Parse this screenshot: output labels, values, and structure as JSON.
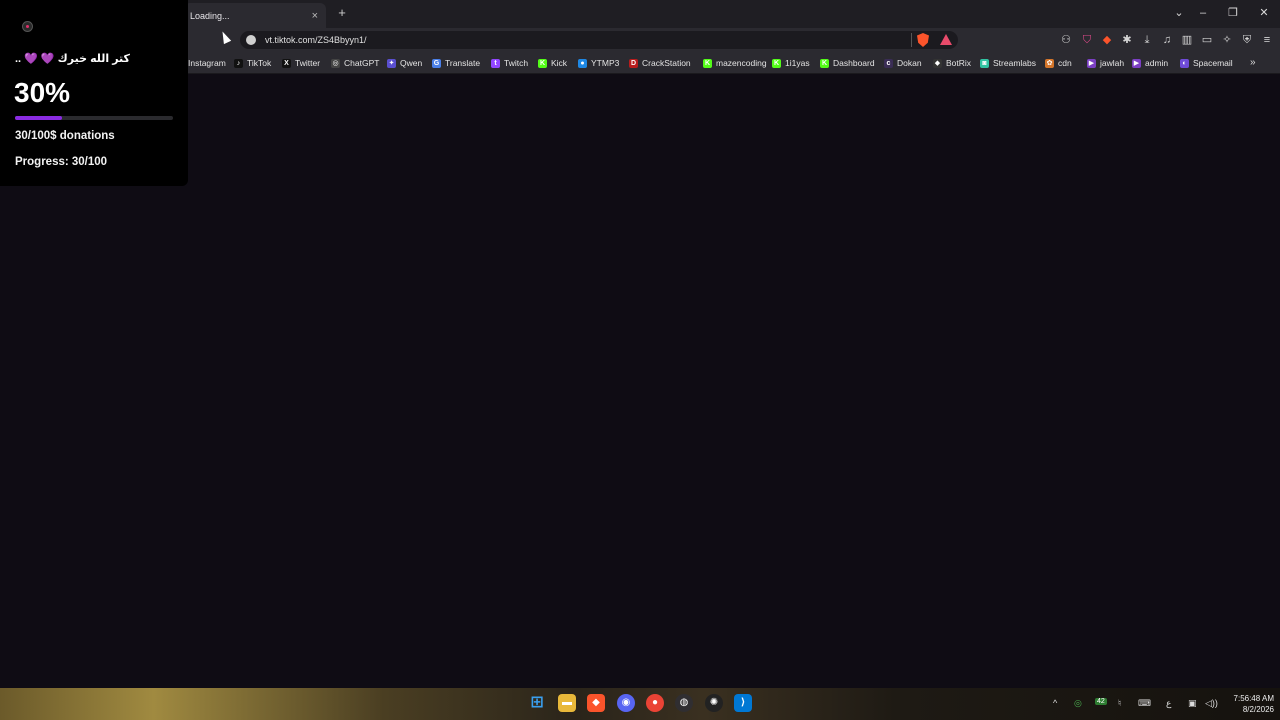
{
  "browser": {
    "tab_title": "Loading...",
    "tab_close": "×",
    "new_tab": "+",
    "url": "vt.tiktok.com/ZS4Bbyyn1/",
    "window_controls": {
      "collapse": "⌄",
      "minimize": "–",
      "restore": "❐",
      "close": "✕"
    }
  },
  "bookmarks": [
    {
      "label": "Instagram",
      "icon": "",
      "color": "#2b2a30"
    },
    {
      "label": "TikTok",
      "icon": "♪",
      "color": "#111111"
    },
    {
      "label": "Twitter",
      "icon": "X",
      "color": "#111111"
    },
    {
      "label": "ChatGPT",
      "icon": "◎",
      "color": "#444444"
    },
    {
      "label": "Qwen",
      "icon": "✦",
      "color": "#5a4fd0"
    },
    {
      "label": "Translate",
      "icon": "G",
      "color": "#4a7fe8"
    },
    {
      "label": "Twitch",
      "icon": "t",
      "color": "#9146ff"
    },
    {
      "label": "Kick",
      "icon": "K",
      "color": "#53fc18"
    },
    {
      "label": "YTMP3",
      "icon": "●",
      "color": "#1e88e5"
    },
    {
      "label": "CrackStation",
      "icon": "D",
      "color": "#b71c1c"
    },
    {
      "label": "mazencoding",
      "icon": "K",
      "color": "#53fc18"
    },
    {
      "label": "1i1yas",
      "icon": "K",
      "color": "#53fc18"
    },
    {
      "label": "Dashboard",
      "icon": "K",
      "color": "#53fc18"
    },
    {
      "label": "Dokan",
      "icon": "c",
      "color": "#3a2d55"
    },
    {
      "label": "BotRix",
      "icon": "◆",
      "color": "#333333"
    },
    {
      "label": "Streamlabs",
      "icon": "◙",
      "color": "#31c3a2"
    },
    {
      "label": "cdn",
      "icon": "✿",
      "color": "#d4752a"
    },
    {
      "label": "jawlah",
      "icon": "▶",
      "color": "#7b3fc4"
    },
    {
      "label": "admin",
      "icon": "▶",
      "color": "#7b3fc4"
    },
    {
      "label": "Spacemail",
      "icon": "◐",
      "color": "#6f4bd8"
    }
  ],
  "bookmarks_more": "»",
  "overlay": {
    "message": "كتر الله خيرك 💜 💜 ..",
    "percent_text": "30%",
    "progress_fraction": 0.3,
    "donations_text": "30/100$ donations",
    "progress_text": "Progress: 30/100",
    "accent_color": "#8a2be2"
  },
  "taskbar": {
    "time": "7:56:48 AM",
    "date": "8/2/2026",
    "tray_badge": "42",
    "tray_lang": "ع"
  }
}
